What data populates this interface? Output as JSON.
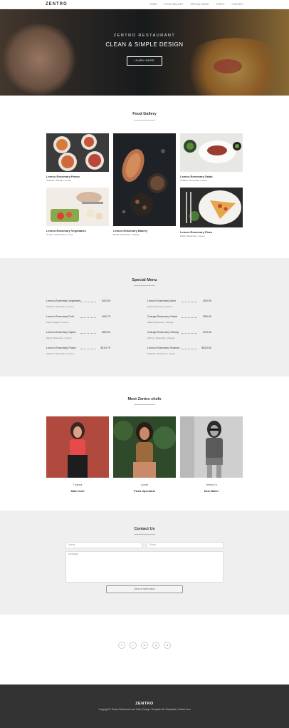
{
  "nav": {
    "brand": "ZENTRO",
    "items": [
      "HOME",
      "FOOD GALLERY",
      "SPECIAL MENU",
      "CHEFS",
      "CONTACT"
    ]
  },
  "hero": {
    "subtitle": "ZENTRO RESTAURANT",
    "title": "CLEAN & SIMPLE DESIGN",
    "button": "LEARN MORE"
  },
  "gallery": {
    "title": "Food Gallery",
    "items": [
      {
        "title": "Lemon-Rosemary Prawn",
        "tags": "Seafood / Shrimp / Lemon"
      },
      {
        "title": "Lemon-Rosemary Vegetables",
        "tags": "Tomato / Rosemary / Lemon"
      },
      {
        "title": "Lemon-Rosemary Bakery",
        "tags": "Bread / Rosemary / Orange"
      },
      {
        "title": "Lemon-Rosemary Salad",
        "tags": "Chicken / Rosemary / Green"
      },
      {
        "title": "Lemon-Rosemary Pizza",
        "tags": "Pasta / Rosemary / Green"
      }
    ]
  },
  "menu": {
    "title": "Special Menu",
    "left": [
      {
        "name": "Lemon-Rosemary Vegetable",
        "price": "$20.50",
        "desc": "Chicken / Rosemary / Lemon"
      },
      {
        "name": "Lemon-Rosemary Pork",
        "price": "$40.75",
        "desc": "Pork / Peppers / Lemon"
      },
      {
        "name": "Lemon-Rosemary Squid",
        "price": "$60.00",
        "desc": "Squid / Rosemary / Lemon"
      },
      {
        "name": "Lemon-Rosemary Prawn",
        "price": "$110.75",
        "desc": "Chicken / Rosemary / Lemon"
      }
    ],
    "right": [
      {
        "name": "Lemon-Rosemary Meat",
        "price": "$30.50",
        "desc": "Meat / Rosemary / Lemon"
      },
      {
        "name": "Orange-Rosemary Salad",
        "price": "$55.00",
        "desc": "Salad / Rosemary / Orange"
      },
      {
        "name": "Orange-Rosemary Shrimp",
        "price": "$78.00",
        "desc": "Shrimp / Rosemary / Orange"
      },
      {
        "name": "Lemon-Rosemary Seafood",
        "price": "$320.50",
        "desc": "Seafood / Rosemary / Lemon"
      }
    ]
  },
  "chefs": {
    "title": "Meet Zentro chefs",
    "items": [
      {
        "name": "Thanya",
        "role": "Main Chef"
      },
      {
        "name": "Lynda",
        "role": "Pizza Specialist"
      },
      {
        "name": "Jenny Ko",
        "role": "New Baker"
      }
    ]
  },
  "contact": {
    "title": "Contact Us",
    "name_placeholder": "Name",
    "email_placeholder": "Email",
    "message_placeholder": "Message",
    "send_button": "Send a reservation"
  },
  "social": [
    "f",
    "t",
    "in",
    "◎",
    "⊙"
  ],
  "footer": {
    "title": "ZENTRO",
    "copyright": "Copyright © Zentro Restaurant and Cafe | Design: Template Mo Templates | Collect from"
  }
}
